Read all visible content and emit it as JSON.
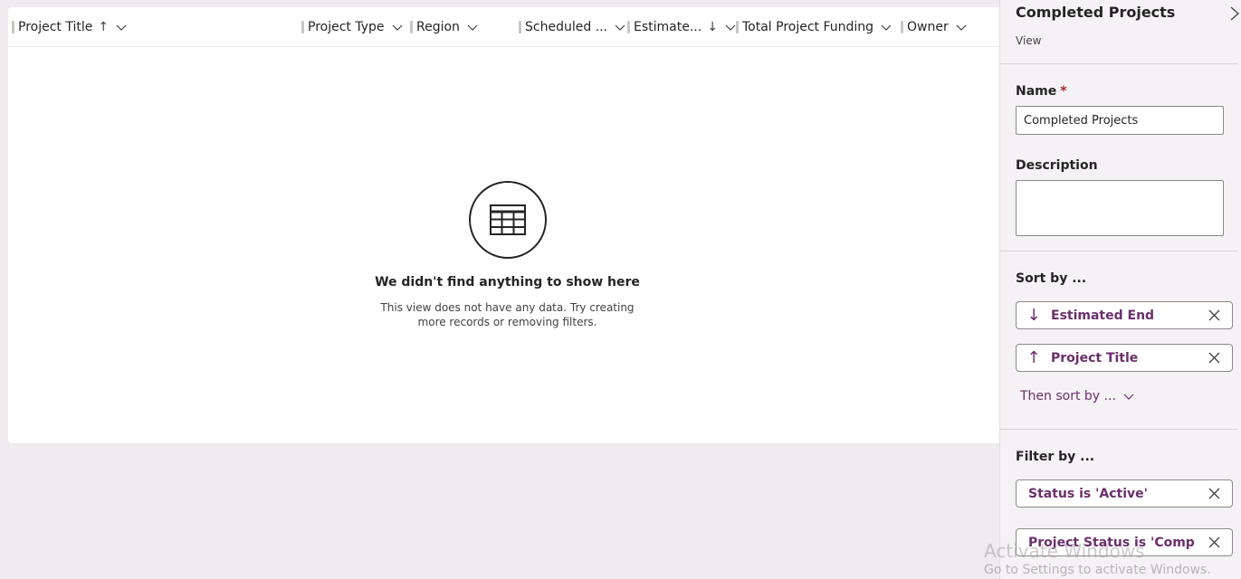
{
  "grid": {
    "columns": [
      {
        "label": "Project Title",
        "sort": "↑"
      },
      {
        "label": "Project Type",
        "sort": ""
      },
      {
        "label": "Region",
        "sort": ""
      },
      {
        "label": "Scheduled ...",
        "sort": ""
      },
      {
        "label": "Estimate...",
        "sort": "↓"
      },
      {
        "label": "Total Project Funding",
        "sort": ""
      },
      {
        "label": "Owner",
        "sort": ""
      }
    ],
    "empty": {
      "icon": "table-icon",
      "title": "We didn't find anything to show here",
      "description": "This view does not have any data. Try creating more records or removing filters."
    }
  },
  "panel": {
    "title": "Completed Projects",
    "subtitle": "View",
    "name_label": "Name",
    "required_mark": "*",
    "name_value": "Completed Projects",
    "description_label": "Description",
    "description_value": "",
    "sort_label": "Sort by ...",
    "sorts": [
      {
        "arrow": "↓",
        "label": "Estimated End"
      },
      {
        "arrow": "↑",
        "label": "Project Title"
      }
    ],
    "then_sort_label": "Then sort by ...",
    "filter_label": "Filter by ...",
    "filters": [
      {
        "label": "Status is 'Active'"
      },
      {
        "label": "Project Status is 'Complet..."
      }
    ]
  },
  "watermark": {
    "line1": "Activate Windows",
    "line2": "Go to Settings to activate Windows."
  },
  "colors": {
    "accent": "#6b2f6b",
    "required": "#a4262c",
    "background": "#efebef"
  }
}
